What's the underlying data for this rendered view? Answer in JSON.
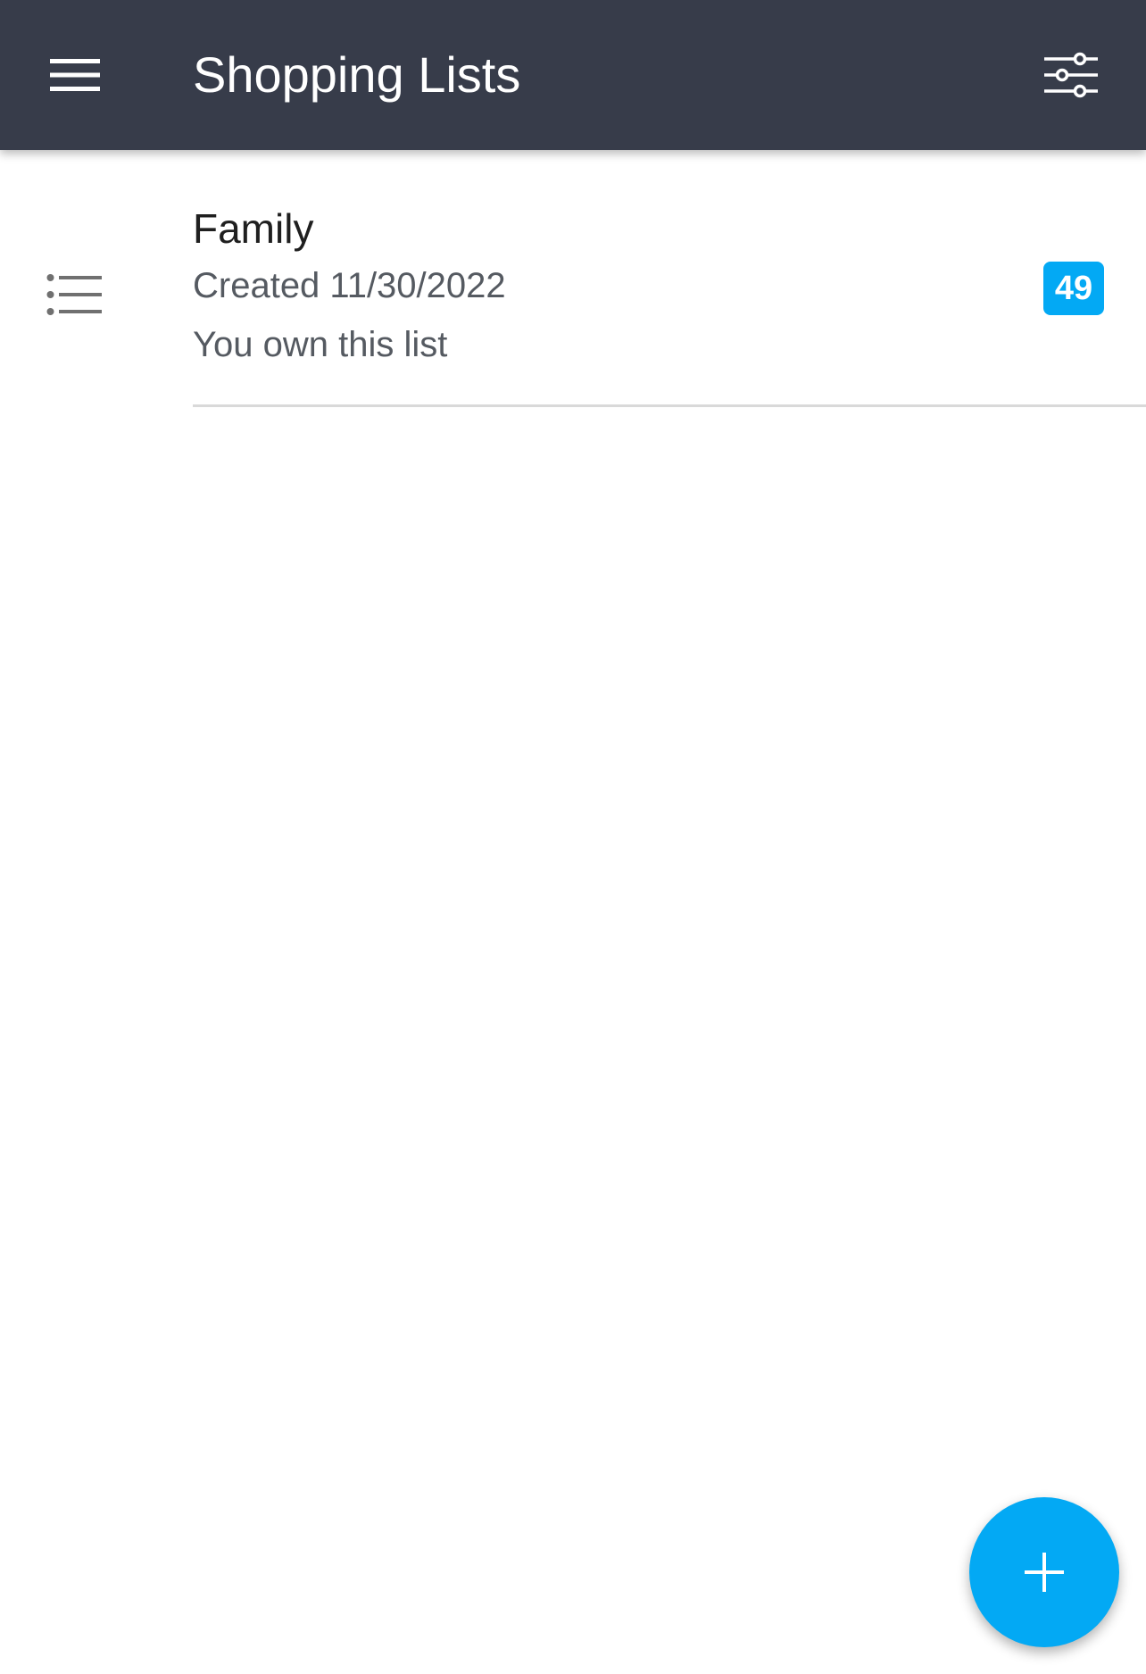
{
  "app_bar": {
    "title": "Shopping Lists",
    "menu_icon": "hamburger-menu-icon",
    "filter_icon": "sliders-filter-icon",
    "background_color": "#373c4a"
  },
  "lists": [
    {
      "icon": "list-icon",
      "name": "Family",
      "created": "Created 11/30/2022",
      "ownership": "You own this list",
      "count": "49"
    }
  ],
  "fab": {
    "icon": "plus-icon",
    "color": "#03a9f4"
  },
  "accent_color": "#03a9f4"
}
